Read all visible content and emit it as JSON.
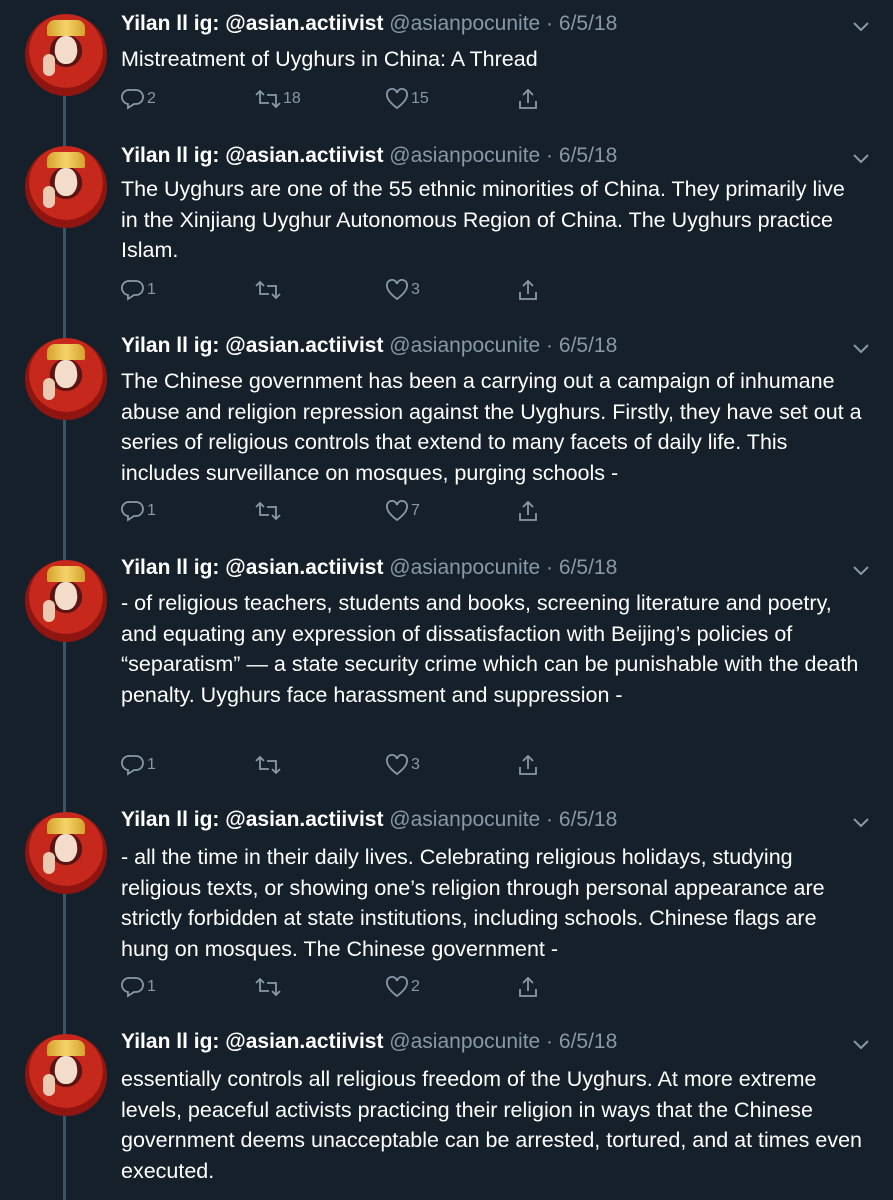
{
  "author": {
    "name": "Yilan ll ig: @asian.actiivist",
    "handle": "@asianpocunite",
    "date": "6/5/18"
  },
  "icons": {
    "reply": "reply-icon",
    "retweet": "retweet-icon",
    "like": "heart-icon",
    "share": "share-icon",
    "menu": "chevron-down-icon"
  },
  "colors": {
    "background": "#15202b",
    "muted": "#8899a6",
    "text": "#ffffff",
    "thread_line": "#3d5466"
  },
  "tweets": [
    {
      "text": "Mistreatment of Uyghurs in China: A Thread",
      "replies": "2",
      "retweets": "18",
      "likes": "15"
    },
    {
      "text": "The Uyghurs are one of the 55 ethnic minorities of China. They primarily live in the Xinjiang Uyghur Autonomous Region of China. The Uyghurs practice Islam.",
      "replies": "1",
      "retweets": "",
      "likes": "3"
    },
    {
      "text": "The Chinese government has been a carrying out a campaign of inhumane abuse and religion repression against the Uyghurs. Firstly, they have set out a series of religious controls that extend to many facets of daily life. This includes surveillance on mosques, purging schools -",
      "replies": "1",
      "retweets": "",
      "likes": "7"
    },
    {
      "text": "- of religious teachers, students and books, screening literature and poetry, and equating any expression of dissatisfaction with Beijing’s policies of “separatism” — a state security crime which can be punishable with the death penalty. Uyghurs face harassment and suppression -",
      "replies": "1",
      "retweets": "",
      "likes": "3"
    },
    {
      "text": "- all the time in their daily lives. Celebrating religious holidays, studying religious texts, or showing one’s religion through personal appearance are strictly forbidden at state institutions, including schools. Chinese flags are hung on mosques.  The Chinese government -",
      "replies": "1",
      "retweets": "",
      "likes": "2"
    },
    {
      "text": "essentially controls all religious freedom of the Uyghurs. At more extreme levels, peaceful activists practicing their religion in ways that the Chinese government deems unacceptable can be arrested, tortured, and at times even executed.",
      "replies": "",
      "retweets": "",
      "likes": ""
    }
  ]
}
